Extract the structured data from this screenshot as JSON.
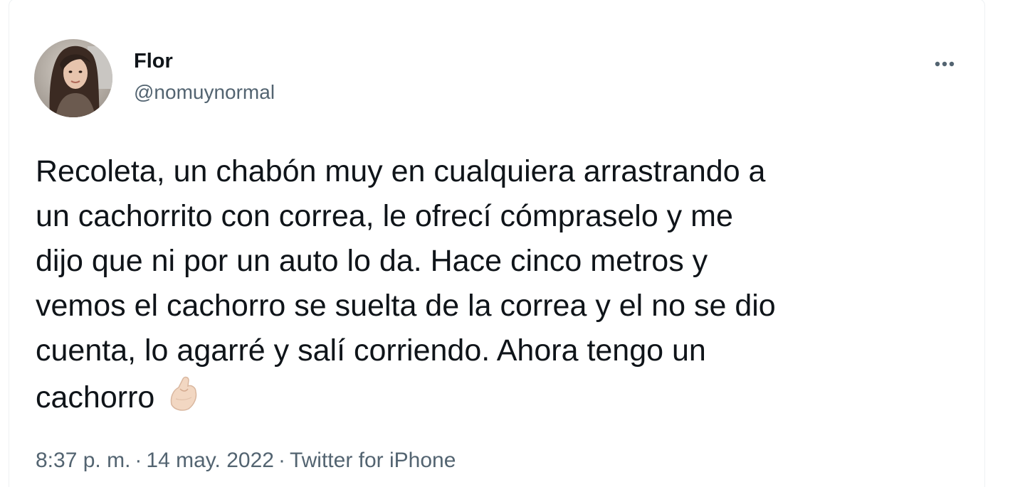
{
  "tweet": {
    "author": {
      "display_name": "Flor",
      "handle": "@nomuynormal"
    },
    "more_icon": "more-horizontal-icon",
    "body_text": "Recoleta, un chabón muy en cualquiera arrastrando a\nun cachorrito con correa, le ofrecí cómpraselo y me\ndijo que ni por un auto lo da. Hace cinco metros y\nvemos el cachorro se suelta de la correa y el no se dio\ncuenta, lo agarré y salí corriendo. Ahora tengo un\ncachorro",
    "emoji": "pinched-fingers-emoji",
    "meta": {
      "time": "8:37 p. m.",
      "separator": "·",
      "date": "14 may. 2022",
      "source": "Twitter for iPhone"
    }
  },
  "colors": {
    "text_primary": "#0f1419",
    "text_secondary": "#536471",
    "border": "#eef1f3"
  }
}
